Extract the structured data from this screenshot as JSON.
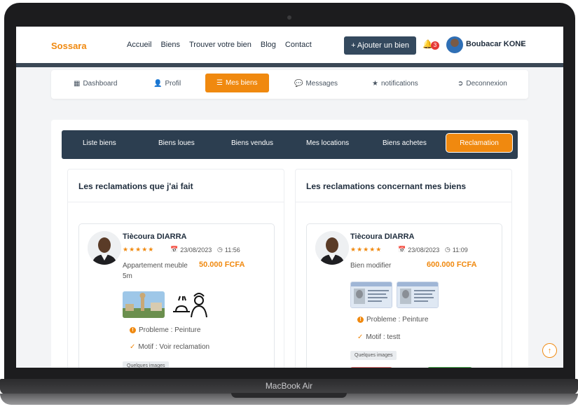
{
  "device": {
    "label": "MacBook Air"
  },
  "navbar": {
    "brand": "Sossara",
    "links": [
      "Accueil",
      "Biens",
      "Trouver votre bien",
      "Blog",
      "Contact"
    ],
    "add_button": "+ Ajouter un bien",
    "notifications_count": "3",
    "user_name": "Boubacar KONE"
  },
  "dashboard_tabs": [
    {
      "label": "Dashboard",
      "icon": "grid-icon"
    },
    {
      "label": "Profil",
      "icon": "user-icon"
    },
    {
      "label": "Mes biens",
      "icon": "list-icon",
      "active": true
    },
    {
      "label": "Messages",
      "icon": "chat-icon"
    },
    {
      "label": "notifications",
      "icon": "star-icon"
    },
    {
      "label": "Deconnexion",
      "icon": "logout-icon"
    }
  ],
  "sub_tabs": [
    "Liste biens",
    "Biens loues",
    "Biens vendus",
    "Mes locations",
    "Biens achetes",
    "Reclamation"
  ],
  "left_column": {
    "title": "Les reclamations que j'ai fait",
    "card": {
      "name": "Tiècoura DIARRA",
      "stars": "★★★★★",
      "date": "23/08/2023",
      "time": "11:56",
      "description": "Appartement meuble 5m",
      "price": "50.000 FCFA",
      "problem": "Probleme : Peinture",
      "motif": "Motif : Voir reclamation",
      "images_label": "Quelques images"
    }
  },
  "right_column": {
    "title": "Les reclamations concernant mes biens",
    "card": {
      "name": "Tiècoura DIARRA",
      "stars": "★★★★★",
      "date": "23/08/2023",
      "time": "11:09",
      "description": "Bien modifier",
      "price": "600.000 FCFA",
      "problem": "Probleme : Peinture",
      "motif": "Motif : testt",
      "images_label": "Quelques images"
    }
  },
  "colors": {
    "accent": "#f0890f",
    "dark": "#2c3e50",
    "button": "#34495e"
  }
}
